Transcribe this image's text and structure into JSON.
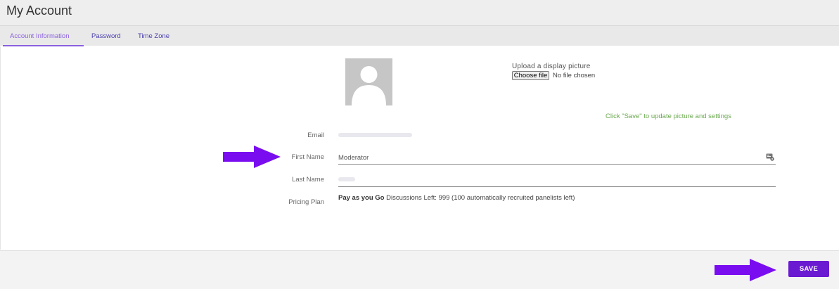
{
  "header": {
    "title": "My Account"
  },
  "tabs": [
    {
      "label": "Account Information",
      "active": true
    },
    {
      "label": "Password",
      "active": false
    },
    {
      "label": "Time Zone",
      "active": false
    }
  ],
  "upload": {
    "label": "Upload a display picture",
    "button_label": "Choose file",
    "status": "No file chosen",
    "hint": "Click \"Save\" to update picture and settings"
  },
  "fields": {
    "email": {
      "label": "Email"
    },
    "first_name": {
      "label": "First Name",
      "value": "Moderator"
    },
    "last_name": {
      "label": "Last Name"
    },
    "pricing_plan": {
      "label": "Pricing Plan",
      "plan": "Pay as you Go",
      "details": "Discussions Left: 999 (100 automatically recruited panelists left)"
    }
  },
  "footer": {
    "save_label": "SAVE"
  },
  "colors": {
    "accent": "#8b61e0",
    "save_button": "#6a1bd1",
    "arrow": "#7a0df0",
    "hint_green": "#6aa84f"
  },
  "icons": {
    "avatar": "user-silhouette-icon",
    "field_action": "contact-card-icon",
    "annotation_arrow": "arrow-right-icon"
  }
}
